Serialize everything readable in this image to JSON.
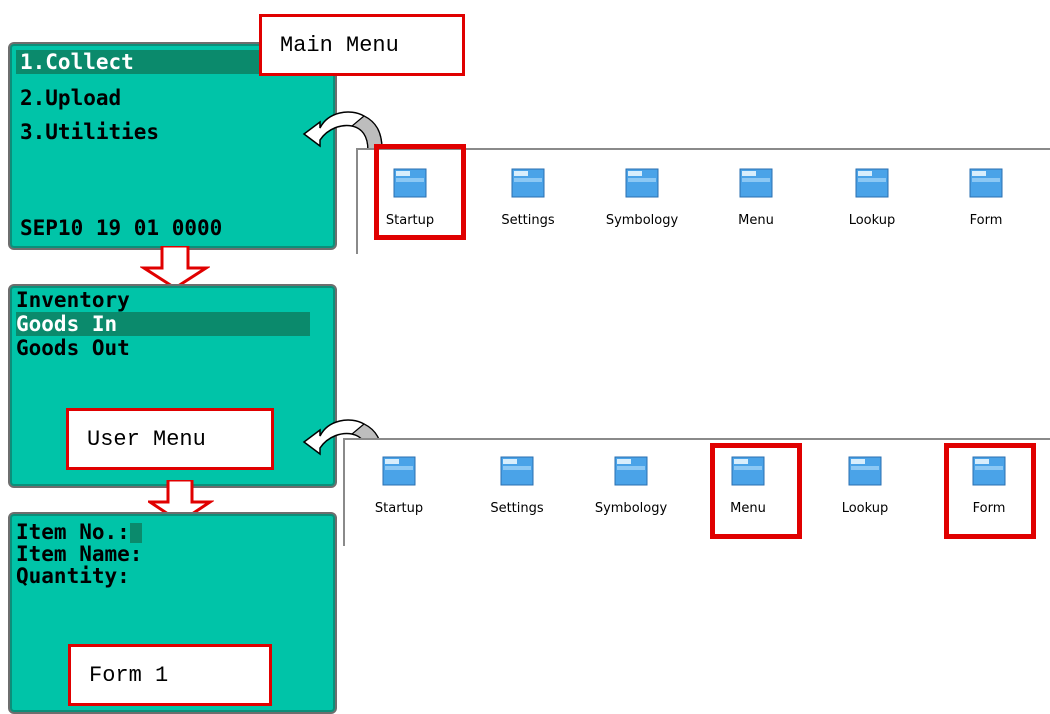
{
  "screens": {
    "main": {
      "lines": [
        "1.Collect",
        "2.Upload",
        "3.Utilities"
      ],
      "footer": "SEP10 19 01 0000",
      "label": "Main Menu"
    },
    "user": {
      "lines": [
        "Inventory",
        "Goods In",
        "Goods Out"
      ],
      "label": "User Menu"
    },
    "form": {
      "lines": [
        "Item No.:",
        "Item Name:",
        "Quantity:"
      ],
      "label": "Form 1"
    }
  },
  "panels": {
    "top": {
      "items": [
        "Startup",
        "Settings",
        "Symbology",
        "Menu",
        "Lookup",
        "Form"
      ],
      "highlighted": [
        "Startup"
      ]
    },
    "bottom": {
      "items": [
        "Startup",
        "Settings",
        "Symbology",
        "Menu",
        "Lookup",
        "Form"
      ],
      "highlighted": [
        "Menu",
        "Form"
      ]
    }
  },
  "colors": {
    "screen": "#00c4a8",
    "highlight": "#0b8a6c",
    "callout": "#e00000",
    "folder": "#4aa3e8"
  }
}
